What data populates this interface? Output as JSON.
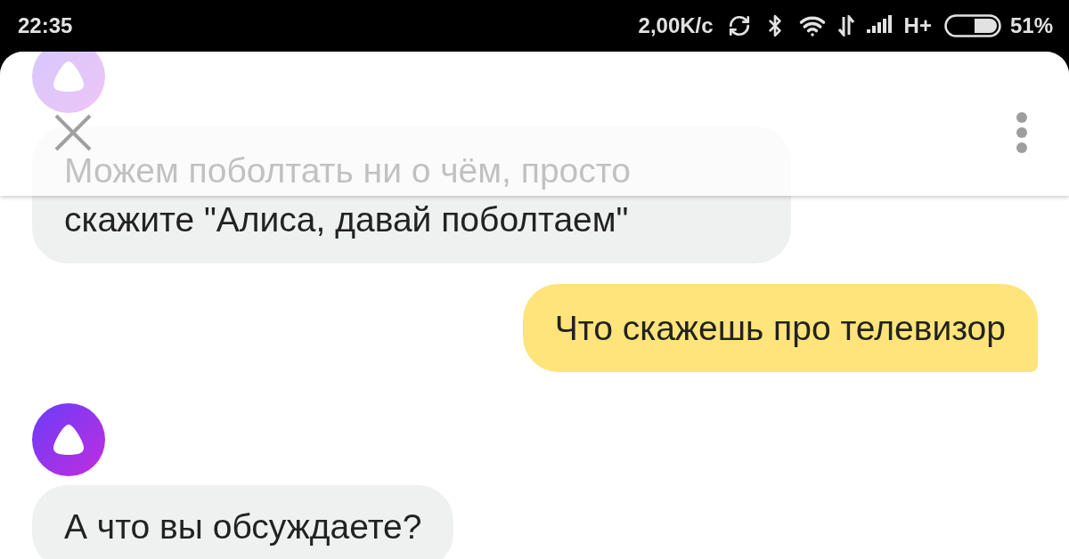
{
  "status_bar": {
    "time": "22:35",
    "speed": "2,00K/c",
    "network": "H+",
    "battery": "51%"
  },
  "messages": [
    {
      "kind": "assistant",
      "text": "Можем поболтать ни о чём, просто скажите \"Алиса, давай поболтаем\""
    },
    {
      "kind": "user",
      "text": "Что скажешь про телевизор"
    },
    {
      "kind": "assistant",
      "text": "А что вы обсуждаете?"
    }
  ]
}
